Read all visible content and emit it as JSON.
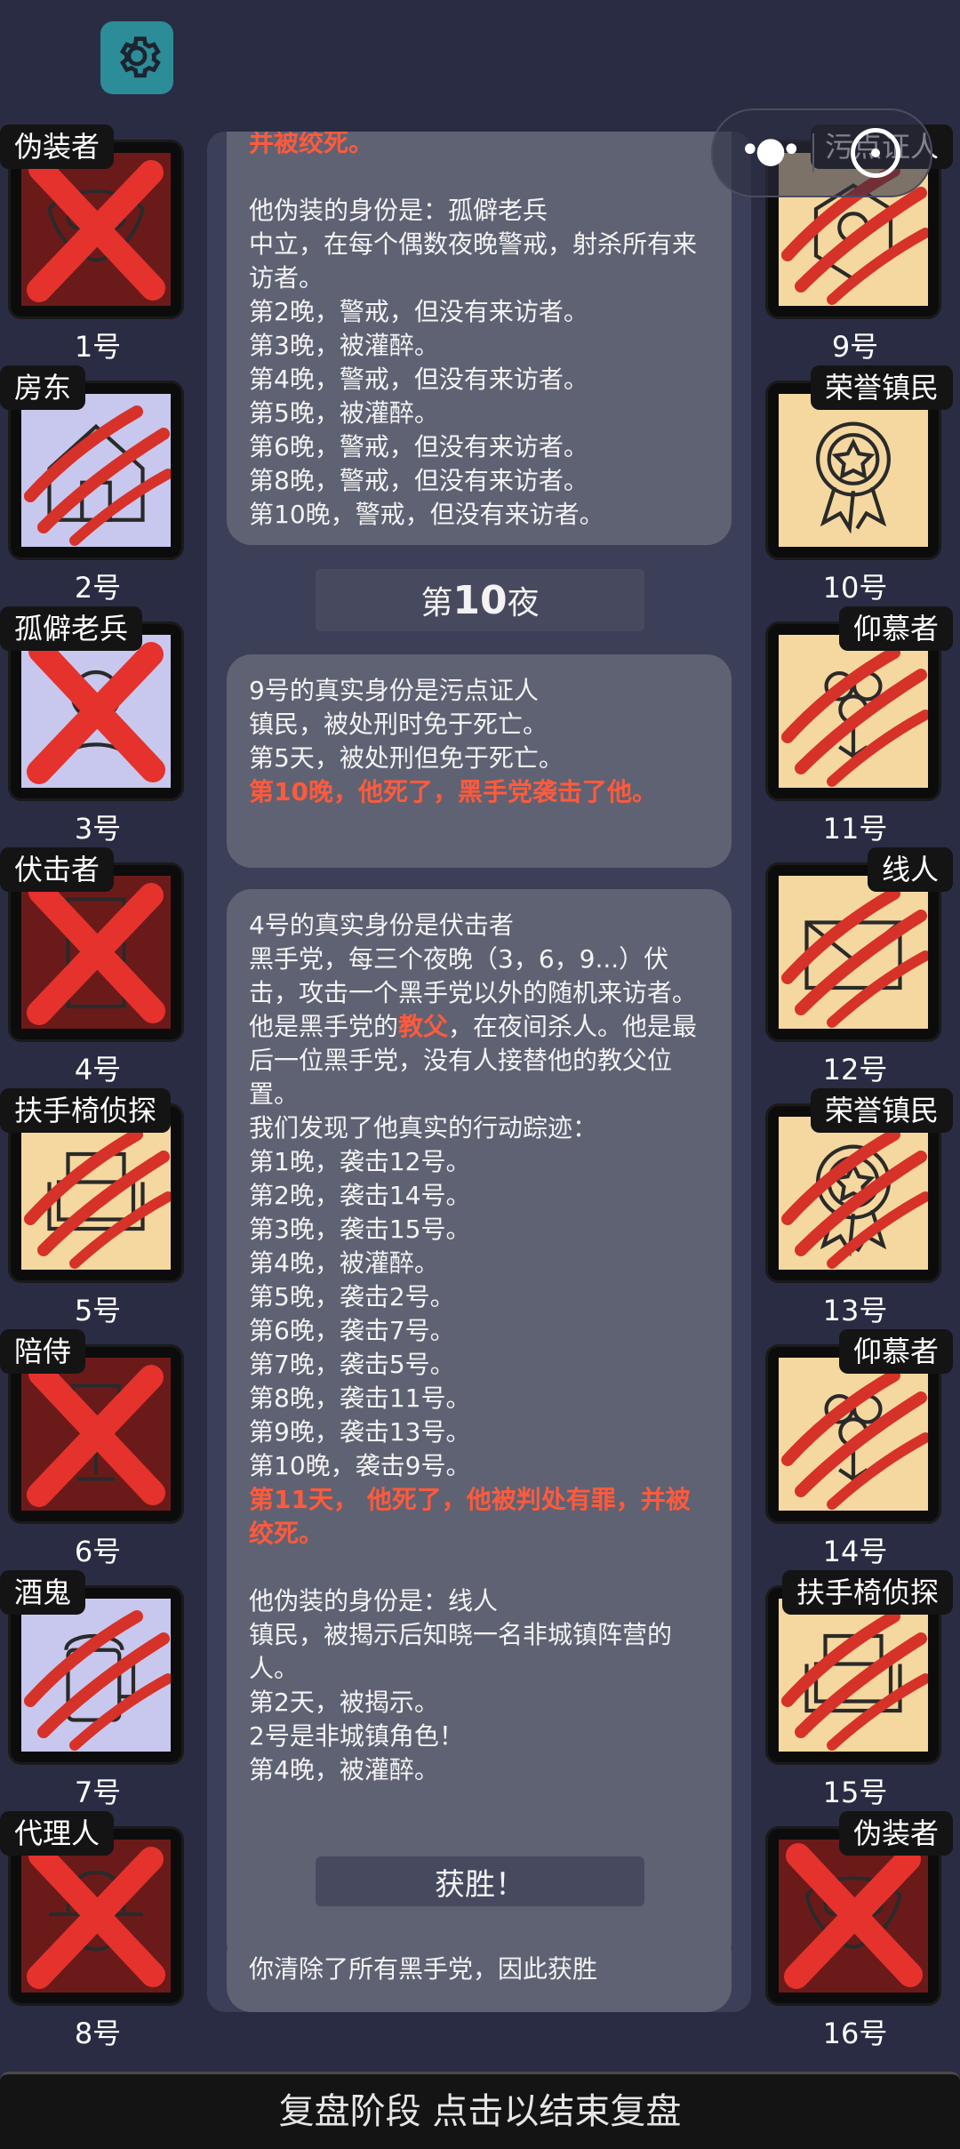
{
  "header": {
    "settings_icon": "gear-icon"
  },
  "miniprogram": {
    "menu_icon": "more-dots-icon",
    "close_icon": "close-circle-icon"
  },
  "colors": {
    "background": "#2a2c43",
    "dead_red": "#6b1a1a",
    "town_cream": "#f5d8a0",
    "neutral_lavender": "#c8c8ee",
    "highlight": "#ff5a3c"
  },
  "left_players": [
    {
      "role": "伪装者",
      "number": "1号",
      "bg": "#6b1a1a",
      "icon": "mask-icon",
      "mark": "x"
    },
    {
      "role": "房东",
      "number": "2号",
      "bg": "#c8c8ee",
      "icon": "house-icon",
      "mark": "claw"
    },
    {
      "role": "孤僻老兵",
      "number": "3号",
      "bg": "#c8c8ee",
      "icon": "veteran-icon",
      "mark": "x"
    },
    {
      "role": "伏击者",
      "number": "4号",
      "bg": "#6b1a1a",
      "icon": "door-icon",
      "mark": "x"
    },
    {
      "role": "扶手椅侦探",
      "number": "5号",
      "bg": "#f5d8a0",
      "icon": "armchair-icon",
      "mark": "claw"
    },
    {
      "role": "陪侍",
      "number": "6号",
      "bg": "#6b1a1a",
      "icon": "wineglass-icon",
      "mark": "x"
    },
    {
      "role": "酒鬼",
      "number": "7号",
      "bg": "#c8c8ee",
      "icon": "beer-icon",
      "mark": "claw"
    },
    {
      "role": "代理人",
      "number": "8号",
      "bg": "#6b1a1a",
      "icon": "agent-hat-icon",
      "mark": "x"
    }
  ],
  "right_players": [
    {
      "role": "污点证人",
      "number": "9号",
      "bg": "#f5d8a0",
      "icon": "witness-icon",
      "mark": "claw"
    },
    {
      "role": "荣誉镇民",
      "number": "10号",
      "bg": "#f5d8a0",
      "icon": "medal-icon",
      "mark": "none"
    },
    {
      "role": "仰慕者",
      "number": "11号",
      "bg": "#f5d8a0",
      "icon": "flowers-icon",
      "mark": "claw"
    },
    {
      "role": "线人",
      "number": "12号",
      "bg": "#f5d8a0",
      "icon": "envelope-icon",
      "mark": "claw"
    },
    {
      "role": "荣誉镇民",
      "number": "13号",
      "bg": "#f5d8a0",
      "icon": "medal-icon",
      "mark": "claw"
    },
    {
      "role": "仰慕者",
      "number": "14号",
      "bg": "#f5d8a0",
      "icon": "flowers-icon",
      "mark": "claw"
    },
    {
      "role": "扶手椅侦探",
      "number": "15号",
      "bg": "#f5d8a0",
      "icon": "armchair-icon",
      "mark": "claw"
    },
    {
      "role": "伪装者",
      "number": "16号",
      "bg": "#6b1a1a",
      "icon": "mask-icon",
      "mark": "x"
    }
  ],
  "log": {
    "top_red": "并被绞死。",
    "top_text": "他伪装的身份是：孤僻老兵\n中立，在每个偶数夜晚警戒，射杀所有来访者。\n第2晚，警戒，但没有来访者。\n第3晚，被灌醉。\n第4晚，警戒，但没有来访者。\n第5晚，被灌醉。\n第6晚，警戒，但没有来访者。\n第8晚，警戒，但没有来访者。\n第10晚，警戒，但没有来访者。",
    "night_prefix": "第",
    "night_number": "10",
    "night_suffix": "夜",
    "p9_text": "9号的真实身份是污点证人\n镇民，被处刑时免于死亡。\n第5天，被处刑但免于死亡。",
    "p9_red": "第10晚，他死了，黑手党袭击了他。",
    "p4_intro": "4号的真实身份是伏击者\n黑手党，每三个夜晚（3，6，9...）伏击，攻击一个黑手党以外的随机来访者。\n他是黑手党的",
    "p4_godfather": "教父",
    "p4_text": "，在夜间杀人。他是最后一位黑手党，没有人接替他的教父位置。\n我们发现了他真实的行动踪迹：\n第1晚，袭击12号。\n第2晚，袭击14号。\n第3晚，袭击15号。\n第4晚，被灌醉。\n第5晚，袭击2号。\n第6晚，袭击7号。\n第7晚，袭击5号。\n第8晚，袭击11号。\n第9晚，袭击13号。\n第10晚，袭击9号。",
    "p4_red": "第11天， 他死了，他被判处有罪，并被绞死。",
    "p4_disguise": "他伪装的身份是：线人\n镇民，被揭示后知晓一名非城镇阵营的人。\n第2天，被揭示。\n2号是非城镇角色！\n第4晚，被灌醉。",
    "victory_title": "获胜！",
    "victory_text": "你清除了所有黑手党，因此获胜"
  },
  "bottom_bar": "复盘阶段 点击以结束复盘"
}
